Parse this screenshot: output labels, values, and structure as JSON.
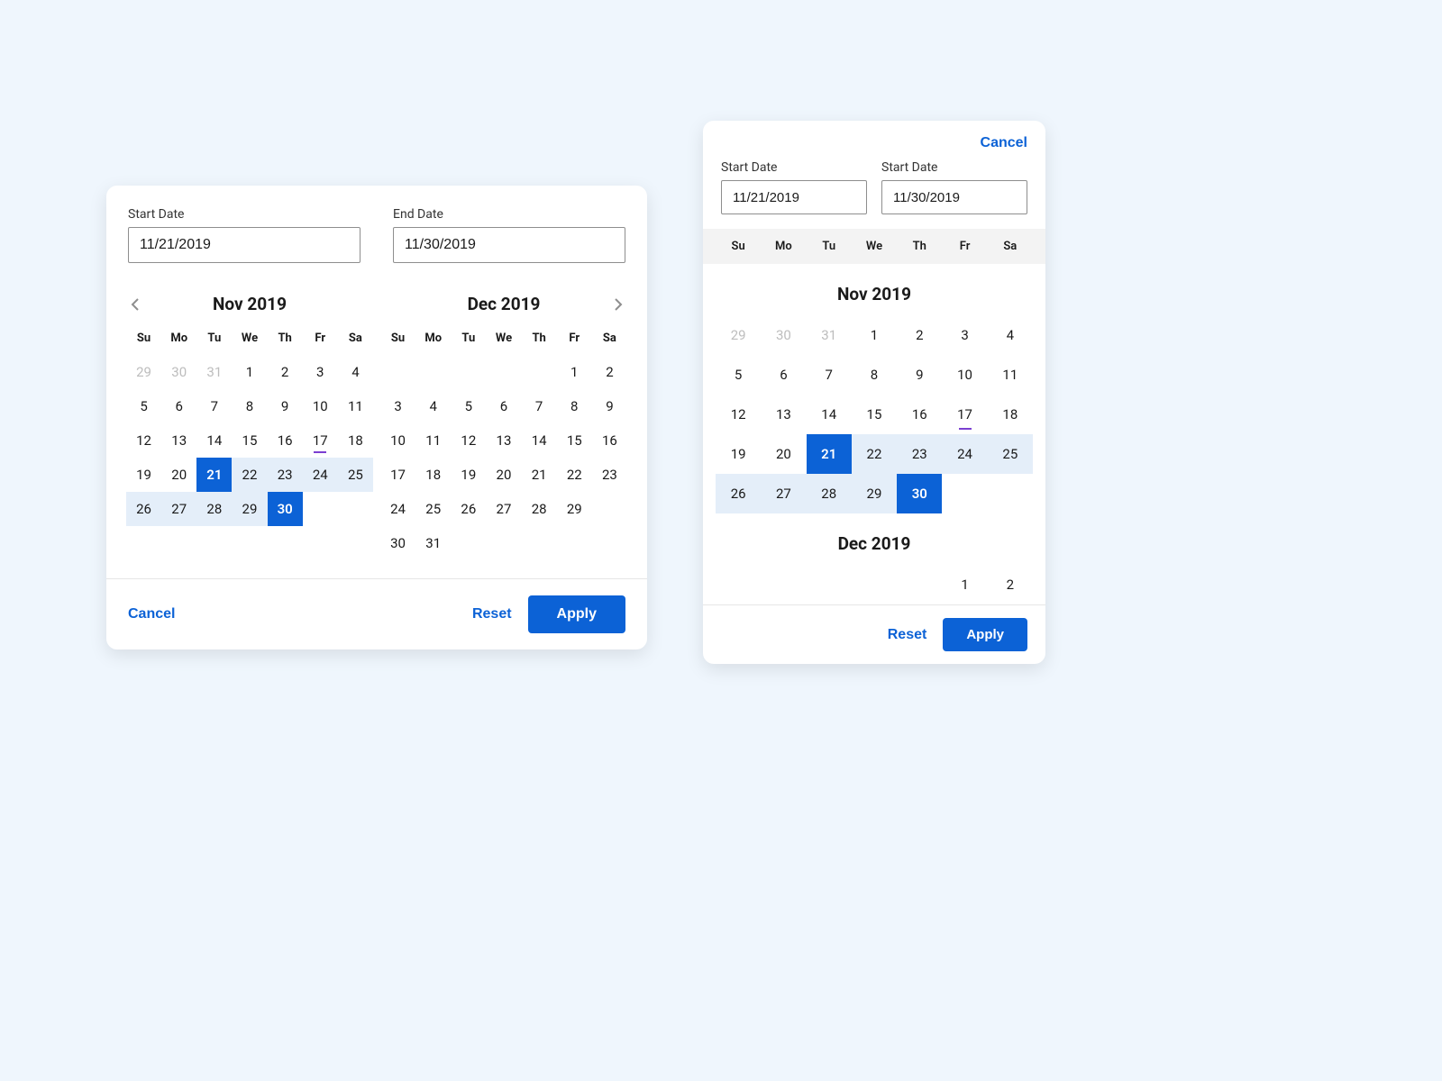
{
  "labels": {
    "start": "Start Date",
    "end": "End Date",
    "startM": "Start Date",
    "endM": "Start Date",
    "cancel": "Cancel",
    "reset": "Reset",
    "apply": "Apply"
  },
  "values": {
    "start": "11/21/2019",
    "end": "11/30/2019"
  },
  "dow": [
    "Su",
    "Mo",
    "Tu",
    "We",
    "Th",
    "Fr",
    "Sa"
  ],
  "months": {
    "nov": {
      "title": "Nov 2019",
      "cells": [
        {
          "n": "29",
          "outside": true
        },
        {
          "n": "30",
          "outside": true
        },
        {
          "n": "31",
          "outside": true
        },
        {
          "n": "1"
        },
        {
          "n": "2"
        },
        {
          "n": "3"
        },
        {
          "n": "4"
        },
        {
          "n": "5"
        },
        {
          "n": "6"
        },
        {
          "n": "7"
        },
        {
          "n": "8"
        },
        {
          "n": "9"
        },
        {
          "n": "10"
        },
        {
          "n": "11"
        },
        {
          "n": "12"
        },
        {
          "n": "13"
        },
        {
          "n": "14"
        },
        {
          "n": "15"
        },
        {
          "n": "16"
        },
        {
          "n": "17",
          "today": true
        },
        {
          "n": "18"
        },
        {
          "n": "19"
        },
        {
          "n": "20"
        },
        {
          "n": "21",
          "sel": true
        },
        {
          "n": "22",
          "in": true
        },
        {
          "n": "23",
          "in": true
        },
        {
          "n": "24",
          "in": true
        },
        {
          "n": "25",
          "in": true
        },
        {
          "n": "26",
          "in": true
        },
        {
          "n": "27",
          "in": true
        },
        {
          "n": "28",
          "in": true
        },
        {
          "n": "29",
          "in": true
        },
        {
          "n": "30",
          "sel": true
        },
        {
          "n": ""
        },
        {
          "n": ""
        }
      ]
    },
    "dec": {
      "title": "Dec 2019",
      "cells": [
        {
          "n": ""
        },
        {
          "n": ""
        },
        {
          "n": ""
        },
        {
          "n": ""
        },
        {
          "n": ""
        },
        {
          "n": "1"
        },
        {
          "n": "2"
        },
        {
          "n": "3"
        },
        {
          "n": "4"
        },
        {
          "n": "5"
        },
        {
          "n": "6"
        },
        {
          "n": "7"
        },
        {
          "n": "8"
        },
        {
          "n": "9"
        },
        {
          "n": "10"
        },
        {
          "n": "11"
        },
        {
          "n": "12"
        },
        {
          "n": "13"
        },
        {
          "n": "14"
        },
        {
          "n": "15"
        },
        {
          "n": "16"
        },
        {
          "n": "17"
        },
        {
          "n": "18"
        },
        {
          "n": "19"
        },
        {
          "n": "20"
        },
        {
          "n": "21"
        },
        {
          "n": "22"
        },
        {
          "n": "23"
        },
        {
          "n": "24"
        },
        {
          "n": "25"
        },
        {
          "n": "26"
        },
        {
          "n": "27"
        },
        {
          "n": "28"
        },
        {
          "n": "29"
        },
        {
          "n": ""
        },
        {
          "n": "30"
        },
        {
          "n": "31"
        },
        {
          "n": ""
        },
        {
          "n": ""
        },
        {
          "n": ""
        },
        {
          "n": ""
        },
        {
          "n": ""
        }
      ]
    },
    "decShort": {
      "title": "Dec 2019",
      "cells": [
        {
          "n": ""
        },
        {
          "n": ""
        },
        {
          "n": ""
        },
        {
          "n": ""
        },
        {
          "n": ""
        },
        {
          "n": "1"
        },
        {
          "n": "2"
        }
      ]
    }
  }
}
